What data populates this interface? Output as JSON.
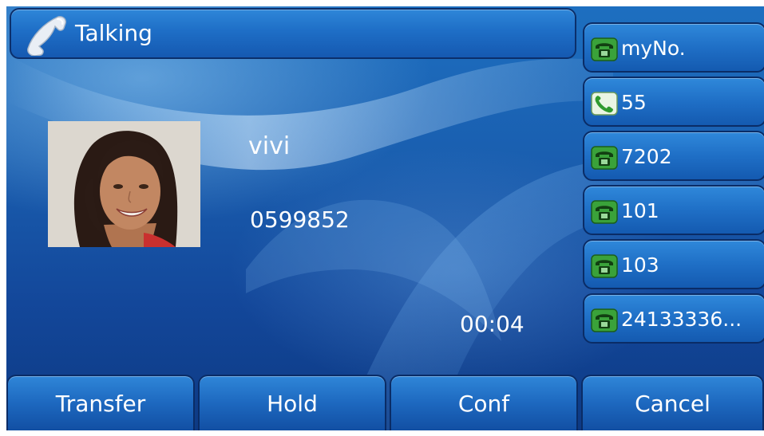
{
  "status": {
    "title": "Talking",
    "icon": "phone-handset-icon"
  },
  "caller": {
    "name": "vivi",
    "number": "0599852",
    "photo": "contact-photo"
  },
  "call": {
    "duration": "00:04"
  },
  "line_keys": [
    {
      "label": "myNo.",
      "icon": "line-registered-icon"
    },
    {
      "label": "55",
      "icon": "line-active-call-icon"
    },
    {
      "label": "7202",
      "icon": "line-registered-icon"
    },
    {
      "label": "101",
      "icon": "line-registered-icon"
    },
    {
      "label": "103",
      "icon": "line-registered-icon"
    },
    {
      "label": "24133336...",
      "icon": "line-registered-icon"
    }
  ],
  "softkeys": [
    {
      "label": "Transfer"
    },
    {
      "label": "Hold"
    },
    {
      "label": "Conf"
    },
    {
      "label": "Cancel"
    }
  ],
  "colors": {
    "background": "#1a5fb0",
    "key_face": "#1f6fc6",
    "key_border": "#0a2c66",
    "text": "#ffffff",
    "line_icon_green": "#3aa23a"
  }
}
